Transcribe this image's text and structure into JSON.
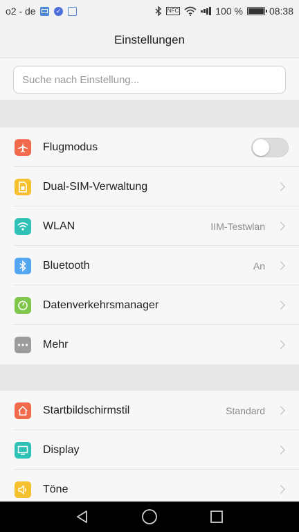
{
  "status_bar": {
    "carrier": "o2 - de",
    "nfc": "NFC",
    "battery_percent": "100 %",
    "time": "08:38"
  },
  "header": {
    "title": "Einstellungen"
  },
  "search": {
    "placeholder": "Suche nach Einstellung..."
  },
  "section1": {
    "items": [
      {
        "label": "Flugmodus",
        "icon": "airplane-icon",
        "color": "#f06a4c",
        "toggle_on": false
      },
      {
        "label": "Dual-SIM-Verwaltung",
        "icon": "sim-card-icon",
        "color": "#f5c12e"
      },
      {
        "label": "WLAN",
        "icon": "wifi-icon",
        "color": "#2fc0b6",
        "value": "IIM-Testwlan"
      },
      {
        "label": "Bluetooth",
        "icon": "bluetooth-icon",
        "color": "#55a6f0",
        "value": "An"
      },
      {
        "label": "Datenverkehrsmanager",
        "icon": "data-usage-icon",
        "color": "#7fc64a"
      },
      {
        "label": "Mehr",
        "icon": "more-dots-icon",
        "color": "#9c9c9c"
      }
    ]
  },
  "section2": {
    "items": [
      {
        "label": "Startbildschirmstil",
        "icon": "home-icon",
        "color": "#f06a4c",
        "value": "Standard"
      },
      {
        "label": "Display",
        "icon": "display-icon",
        "color": "#2fc0b6"
      },
      {
        "label": "Töne",
        "icon": "sound-icon",
        "color": "#f5c12e"
      }
    ]
  }
}
